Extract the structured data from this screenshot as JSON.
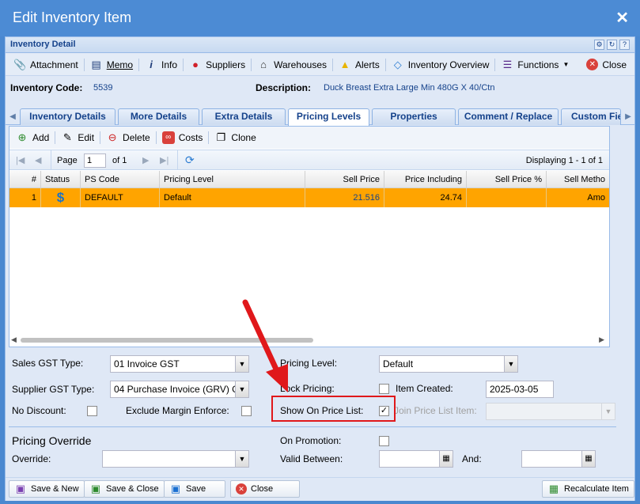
{
  "window": {
    "title": "Edit Inventory Item"
  },
  "panel": {
    "title": "Inventory Detail"
  },
  "toolbar": {
    "attachment": "Attachment",
    "memo": "Memo",
    "info": "Info",
    "suppliers": "Suppliers",
    "warehouses": "Warehouses",
    "alerts": "Alerts",
    "inventory_overview": "Inventory Overview",
    "functions": "Functions",
    "close": "Close"
  },
  "info": {
    "code_label": "Inventory Code:",
    "code_value": "5539",
    "desc_label": "Description:",
    "desc_value": "Duck Breast Extra Large Min 480G X 40/Ctn"
  },
  "tabs": [
    {
      "label": "Inventory Details"
    },
    {
      "label": "More Details"
    },
    {
      "label": "Extra Details"
    },
    {
      "label": "Pricing Levels"
    },
    {
      "label": "Properties"
    },
    {
      "label": "Comment / Replace"
    },
    {
      "label": "Custom Fie"
    }
  ],
  "grid_toolbar": {
    "add": "Add",
    "edit": "Edit",
    "delete": "Delete",
    "costs": "Costs",
    "clone": "Clone"
  },
  "pager": {
    "page_label": "Page",
    "page_value": "1",
    "of_label": "of 1",
    "displaying": "Displaying 1 - 1 of 1"
  },
  "columns": [
    "#",
    "Status",
    "PS Code",
    "Pricing Level",
    "Sell Price",
    "Price Including",
    "Sell Price %",
    "Sell Metho"
  ],
  "rows": [
    {
      "num": "1",
      "status": "$",
      "ps_code": "DEFAULT",
      "pricing_level": "Default",
      "sell_price": "21.516",
      "price_including": "24.74",
      "sell_price_pct": "",
      "sell_method": "Amo"
    }
  ],
  "form": {
    "sales_gst_label": "Sales GST Type:",
    "sales_gst_value": "01 Invoice GST",
    "supplier_gst_label": "Supplier GST Type:",
    "supplier_gst_value": "04 Purchase Invoice (GRV) G",
    "no_discount_label": "No Discount:",
    "exclude_margin_label": "Exclude Margin Enforce:",
    "pricing_level_label": "Pricing Level:",
    "pricing_level_value": "Default",
    "lock_pricing_label": "Lock Pricing:",
    "item_created_label": "Item Created:",
    "item_created_value": "2025-03-05",
    "show_on_price_list_label": "Show On Price List:",
    "join_price_list_label": "Join Price List Item:",
    "pricing_override_heading": "Pricing Override",
    "override_label": "Override:",
    "on_promotion_label": "On Promotion:",
    "valid_between_label": "Valid Between:",
    "and_label": "And:"
  },
  "buttons": {
    "save_new": "Save & New",
    "save_close": "Save & Close",
    "save": "Save",
    "close": "Close",
    "recalculate": "Recalculate Item"
  },
  "colors": {
    "selected_row": "#ffa400",
    "annotation_red": "#e0181b",
    "title_blue": "#4c8bd4"
  }
}
